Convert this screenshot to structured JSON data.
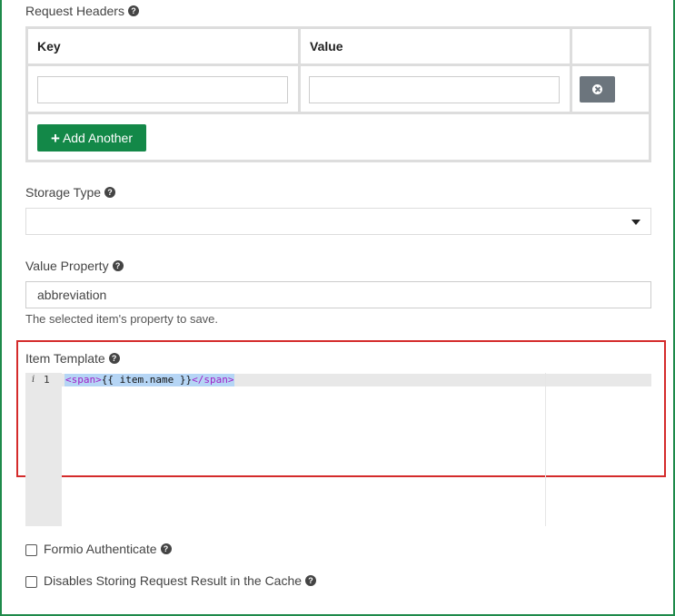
{
  "request_headers": {
    "label": "Request Headers",
    "columns": [
      "Key",
      "Value"
    ],
    "rows": [
      {
        "key": "",
        "value": ""
      }
    ],
    "add_button_label": "Add Another"
  },
  "storage_type": {
    "label": "Storage Type",
    "selected": ""
  },
  "value_property": {
    "label": "Value Property",
    "value": "abbreviation",
    "description": "The selected item's property to save."
  },
  "item_template": {
    "label": "Item Template",
    "line_number": "1",
    "gutter_marker": "i",
    "code": {
      "open_tag": "<span>",
      "content": "{{ item.name }}",
      "close_tag": "</span>"
    }
  },
  "checkboxes": [
    {
      "label": "Formio Authenticate",
      "checked": false
    },
    {
      "label": "Disables Storing Request Result in the Cache",
      "checked": false
    }
  ],
  "help_icon_glyph": "?",
  "colors": {
    "accent_green": "#138848",
    "remove_gray": "#6c757d",
    "highlight_red": "#d42b2b",
    "frame_green": "#1e8a4a"
  }
}
